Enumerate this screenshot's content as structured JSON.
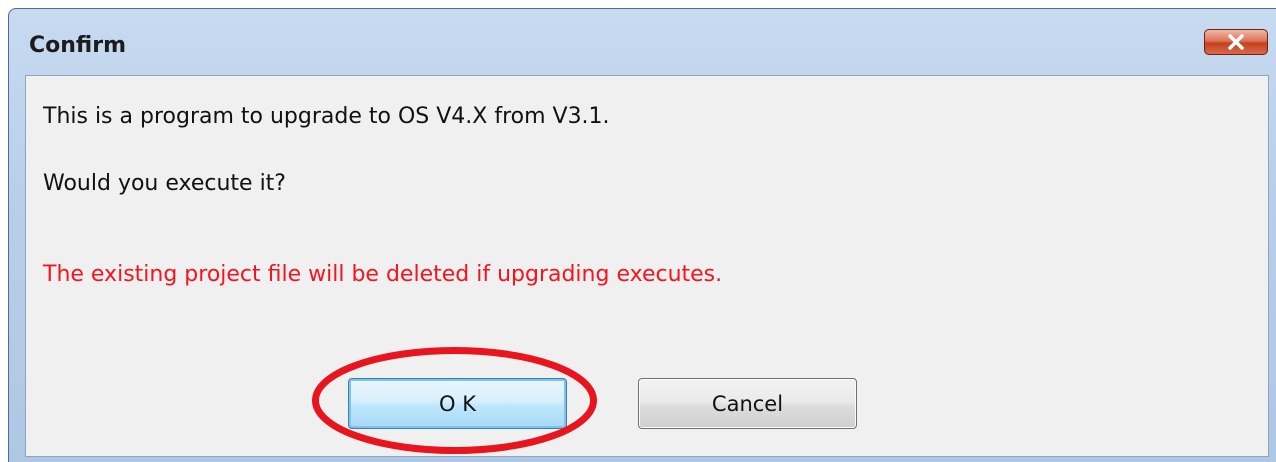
{
  "window": {
    "title": "Confirm"
  },
  "message": {
    "line1": "This is a program to upgrade to OS V4.X from V3.1.",
    "line2": "Would you execute it?",
    "warning": "The existing project file will be deleted if upgrading executes."
  },
  "buttons": {
    "ok_label": "O K",
    "cancel_label": "Cancel"
  },
  "icons": {
    "close": "close-icon"
  },
  "colors": {
    "warning_text": "#f5141e",
    "highlight_ellipse": "#e8141e",
    "close_button": "#c3421f",
    "titlebar": "#b9cfe9"
  }
}
